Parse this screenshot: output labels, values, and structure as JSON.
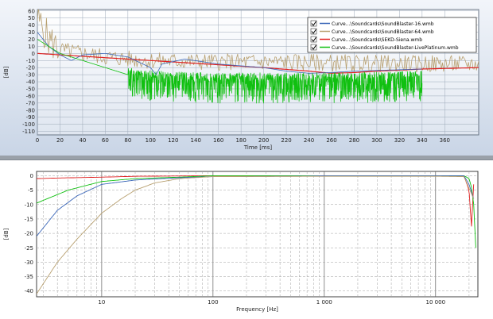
{
  "top_chart": {
    "xlabel": "Time [ms]",
    "ylabel": "[dB]",
    "x_ticks": [
      "0",
      "20",
      "40",
      "60",
      "80",
      "100",
      "120",
      "140",
      "160",
      "180",
      "200",
      "220",
      "240",
      "260",
      "280",
      "300",
      "320",
      "340",
      "360"
    ],
    "xlim": [
      0,
      390
    ],
    "y_ticks": [
      "60",
      "50",
      "40",
      "30",
      "20",
      "10",
      "0",
      "-10",
      "-20",
      "-30",
      "-40",
      "-50",
      "-60",
      "-70",
      "-80",
      "-90",
      "-100",
      "-110"
    ],
    "ylim": [
      -115,
      62
    ],
    "legend": [
      {
        "label": "Curve...\\Soundcards\\SoundBlaster-16.wmb",
        "color": "#3a66b8",
        "checked": true
      },
      {
        "label": "Curve...\\Soundcards\\SoundBlaster-64.wmb",
        "color": "#b8a070",
        "checked": true
      },
      {
        "label": "Curve...\\Soundcards\\SEKD-Siena.wmb",
        "color": "#e02020",
        "checked": true
      },
      {
        "label": "Curve...\\Soundcards\\SoundBlaster-LivePlatinum.wmb",
        "color": "#10c010",
        "checked": true
      }
    ],
    "colors": {
      "grid": "#9ca8b8",
      "plot_bg_top": "#ffffff",
      "plot_bg_bottom": "#dfe6f0"
    }
  },
  "bottom_chart": {
    "xlabel": "Frequency [Hz]",
    "ylabel": "[dB]",
    "x_ticks": [
      "10",
      "100",
      "1 000",
      "10 000"
    ],
    "xlim": [
      2.6,
      24000
    ],
    "x_scale": "log",
    "y_ticks": [
      "0",
      "-5",
      "-10",
      "-15",
      "-20",
      "-25",
      "-30",
      "-35",
      "-40"
    ],
    "ylim": [
      -42,
      1.5
    ],
    "colors": {
      "grid_major": "#606060",
      "grid_minor": "#a0a0a0"
    }
  },
  "chart_data": [
    {
      "type": "line",
      "title": "",
      "xlabel": "Time [ms]",
      "ylabel": "[dB]",
      "xlim": [
        0,
        390
      ],
      "ylim": [
        -115,
        62
      ],
      "series": [
        {
          "name": "Curve...\\Soundcards\\SoundBlaster-16.wmb",
          "color": "#3a66b8",
          "x": [
            0,
            5,
            10,
            20,
            30,
            40,
            60,
            80,
            100,
            105,
            110,
            130,
            160,
            200,
            220,
            240,
            260,
            280,
            300,
            320,
            340
          ],
          "y": [
            30,
            20,
            10,
            -2,
            -10,
            -2,
            0,
            -5,
            -20,
            -30,
            -15,
            -8,
            -15,
            -20,
            -25,
            -28,
            -27,
            -25,
            -24,
            -23,
            -22
          ]
        },
        {
          "name": "Curve...\\Soundcards\\SoundBlaster-64.wmb",
          "color": "#b8a070",
          "x": [
            0,
            10,
            20,
            40,
            60,
            80,
            100,
            150,
            200,
            250,
            300,
            350,
            390
          ],
          "y": [
            50,
            20,
            5,
            0,
            -5,
            -8,
            -10,
            -12,
            -12,
            -13,
            -14,
            -15,
            -15
          ]
        },
        {
          "name": "Curve...\\Soundcards\\SEKD-Siena.wmb",
          "color": "#e02020",
          "x": [
            0,
            20,
            50,
            100,
            150,
            200,
            240,
            260,
            280,
            300,
            340,
            390
          ],
          "y": [
            0,
            -2,
            -5,
            -10,
            -15,
            -20,
            -25,
            -28,
            -27,
            -25,
            -22,
            -20
          ]
        },
        {
          "name": "Curve...\\Soundcards\\SoundBlaster-LivePlatinum.wmb",
          "color": "#10c010",
          "x": [
            0,
            20,
            40,
            60,
            80,
            100,
            150,
            200,
            250,
            300,
            340
          ],
          "y": [
            20,
            0,
            -10,
            -20,
            -30,
            -35,
            -38,
            -38,
            -38,
            -37,
            -35
          ]
        }
      ]
    },
    {
      "type": "line",
      "title": "",
      "xlabel": "Frequency [Hz]",
      "ylabel": "[dB]",
      "x_scale": "log",
      "xlim": [
        2.6,
        24000
      ],
      "ylim": [
        -42,
        1.5
      ],
      "series": [
        {
          "name": "SEKD-Siena",
          "color": "#e02020",
          "x": [
            2.6,
            4,
            10,
            20,
            100,
            1000,
            10000,
            18000,
            20000,
            21000,
            22000
          ],
          "y": [
            -1.0,
            -0.8,
            -0.5,
            -0.2,
            0,
            0,
            0,
            0,
            -5,
            -18,
            -3
          ]
        },
        {
          "name": "SoundBlaster-LivePlatinum",
          "color": "#10c010",
          "x": [
            2.6,
            5,
            10,
            20,
            50,
            100,
            1000,
            10000,
            18000,
            20000,
            21000,
            22000,
            23000
          ],
          "y": [
            -9.5,
            -5,
            -2,
            -1,
            -0.5,
            0,
            0,
            0,
            0,
            -1,
            -4,
            -10,
            -25
          ]
        },
        {
          "name": "SoundBlaster-16",
          "color": "#3a66b8",
          "x": [
            2.6,
            4,
            6,
            10,
            20,
            50,
            100,
            500,
            1000,
            10000,
            18000,
            20000,
            22000
          ],
          "y": [
            -21,
            -12,
            -7,
            -3,
            -1.5,
            -0.7,
            -0.3,
            -0.2,
            0,
            0,
            0,
            -3,
            -8
          ]
        },
        {
          "name": "SoundBlaster-64",
          "color": "#b8a070",
          "x": [
            2.6,
            4,
            6,
            10,
            15,
            20,
            30,
            50,
            100,
            1000,
            10000,
            18000,
            22000
          ],
          "y": [
            -41,
            -30,
            -22,
            -13,
            -8,
            -5,
            -2.5,
            -1,
            -0.3,
            -0.2,
            -0.2,
            -0.3,
            -8
          ]
        }
      ]
    }
  ]
}
